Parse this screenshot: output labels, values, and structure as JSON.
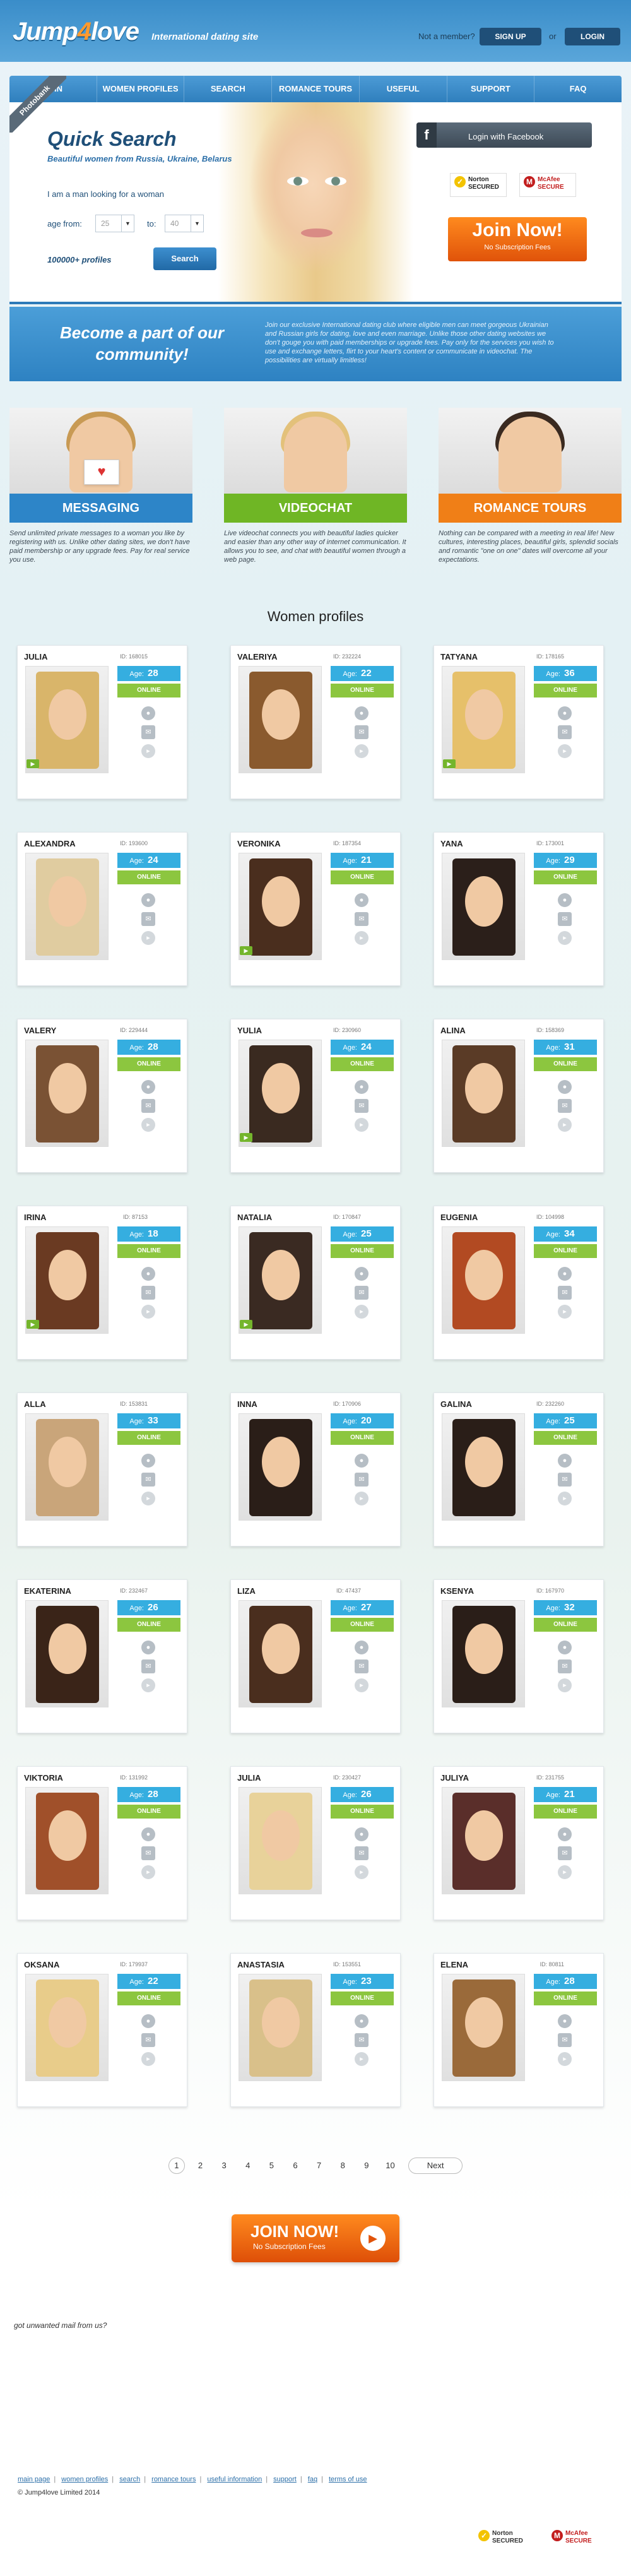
{
  "header": {
    "logo_main": "Jump",
    "logo_four": "4",
    "logo_end": "love",
    "tagline": "International dating site",
    "not_member": "Not a member?",
    "signup": "SIGN UP",
    "or": "or",
    "login": "LOGIN"
  },
  "nav": [
    "JOIN",
    "WOMEN PROFILES",
    "SEARCH",
    "ROMANCE TOURS",
    "USEFUL INFORMATION",
    "SUPPORT",
    "FAQ"
  ],
  "ribbon": "Photobank",
  "quick_search": {
    "title": "Quick Search",
    "subtitle": "Beautiful women from Russia, Ukraine, Belarus",
    "looking": "I am a man looking for a woman",
    "age_from": "age from:",
    "age_to": "to:",
    "from_value": "25",
    "to_value": "40",
    "profiles": "100000+ profiles",
    "search_btn": "Search"
  },
  "facebook": {
    "icon": "f",
    "label": "Login with Facebook"
  },
  "seals": {
    "norton": "Norton SECURED",
    "mcafee": "McAfee SECURE"
  },
  "join_hero": {
    "big": "Join Now!",
    "small": "No Subscription Fees"
  },
  "community": {
    "title": "Become a part of our community!",
    "text": "Join our exclusive International dating club where eligible men can meet gorgeous Ukrainian and Russian girls for dating, love and even marriage. Unlike those other dating websites we don't gouge you with paid memberships or upgrade fees. Pay only for the services you wish to use and exchange letters, flirt to your heart's content or communicate in videochat. The possibilities are virtually limitless!"
  },
  "features": [
    {
      "label": "MESSAGING",
      "desc": "Send unlimited private messages to a woman you like by registering with us. Unlike other dating sites, we don't have paid membership or any upgrade fees. Pay for real service you use."
    },
    {
      "label": "VIDEOCHAT",
      "desc": "Live videochat connects you with beautiful ladies quicker and easier than any other way of internet communication. It allows you to see, and chat with beautiful women through a web page."
    },
    {
      "label": "ROMANCE TOURS",
      "desc": "Nothing can be compared with a meeting in real life! New cultures, interesting places, beautiful girls, splendid socials and romantic \"one on one\" dates will overcome all your expectations."
    }
  ],
  "women_title": "Women profiles",
  "age_label": "Age:",
  "online_label": "ONLINE",
  "profiles": [
    {
      "name": "JULIA",
      "id": "ID: 168015",
      "age": "28",
      "cam": true,
      "hair": "#d9b56a"
    },
    {
      "name": "VALERIYA",
      "id": "ID: 232224",
      "age": "22",
      "cam": false,
      "hair": "#8a5a2e"
    },
    {
      "name": "TATYANA",
      "id": "ID: 178165",
      "age": "36",
      "cam": true,
      "hair": "#e6c06a"
    },
    {
      "name": "ALEXANDRA",
      "id": "ID: 193600",
      "age": "24",
      "cam": false,
      "hair": "#e0cca0"
    },
    {
      "name": "VERONIKA",
      "id": "ID: 187354",
      "age": "21",
      "cam": true,
      "hair": "#4a2e1e"
    },
    {
      "name": "YANA",
      "id": "ID: 173001",
      "age": "29",
      "cam": false,
      "hair": "#2b1f1a"
    },
    {
      "name": "VALERY",
      "id": "ID: 229444",
      "age": "28",
      "cam": false,
      "hair": "#7a5234"
    },
    {
      "name": "YULIA",
      "id": "ID: 230960",
      "age": "24",
      "cam": true,
      "hair": "#3a2a20"
    },
    {
      "name": "ALINA",
      "id": "ID: 158369",
      "age": "31",
      "cam": false,
      "hair": "#5a3b26"
    },
    {
      "name": "IRINA",
      "id": "ID: 87153",
      "age": "18",
      "cam": true,
      "hair": "#6a3a22"
    },
    {
      "name": "NATALIA",
      "id": "ID: 170847",
      "age": "25",
      "cam": true,
      "hair": "#3a2a22"
    },
    {
      "name": "EUGENIA",
      "id": "ID: 104998",
      "age": "34",
      "cam": false,
      "hair": "#b24a22"
    },
    {
      "name": "ALLA",
      "id": "ID: 153831",
      "age": "33",
      "cam": false,
      "hair": "#c9a57a"
    },
    {
      "name": "INNA",
      "id": "ID: 170906",
      "age": "20",
      "cam": false,
      "hair": "#2a1e18"
    },
    {
      "name": "GALINA",
      "id": "ID: 232260",
      "age": "25",
      "cam": false,
      "hair": "#2a1e18"
    },
    {
      "name": "EKATERINA",
      "id": "ID: 232467",
      "age": "26",
      "cam": false,
      "hair": "#3a2418"
    },
    {
      "name": "LIZA",
      "id": "ID: 47437",
      "age": "27",
      "cam": false,
      "hair": "#4a2e1e"
    },
    {
      "name": "KSENYA",
      "id": "ID: 167970",
      "age": "32",
      "cam": false,
      "hair": "#2a1e18"
    },
    {
      "name": "VIKTORIA",
      "id": "ID: 131992",
      "age": "28",
      "cam": false,
      "hair": "#a0502a"
    },
    {
      "name": "JULIA",
      "id": "ID: 230427",
      "age": "26",
      "cam": false,
      "hair": "#e8d29a"
    },
    {
      "name": "JULIYA",
      "id": "ID: 231755",
      "age": "21",
      "cam": false,
      "hair": "#5a2e2a"
    },
    {
      "name": "OKSANA",
      "id": "ID: 179937",
      "age": "22",
      "cam": false,
      "hair": "#e8cc8a"
    },
    {
      "name": "ANASTASIA",
      "id": "ID: 153551",
      "age": "23",
      "cam": false,
      "hair": "#d9c08a"
    },
    {
      "name": "ELENA",
      "id": "ID: 80811",
      "age": "28",
      "cam": false,
      "hair": "#9a6a3a"
    }
  ],
  "pagination": {
    "pages": [
      "1",
      "2",
      "3",
      "4",
      "5",
      "6",
      "7",
      "8",
      "9",
      "10"
    ],
    "next": "Next"
  },
  "join_bottom": {
    "big": "JOIN NOW!",
    "small": "No Subscription Fees"
  },
  "unwanted": "got unwanted mail from us?",
  "footer": {
    "links": [
      "main page",
      "women profiles",
      "search",
      "romance tours",
      "useful information",
      "support",
      "faq",
      "terms of use"
    ],
    "copyright": "© Jump4love Limited 2014"
  },
  "colors": {
    "primary": "#2d85c8",
    "accent_orange": "#f07f17",
    "online_green": "#8cc63f",
    "age_blue": "#35aee0"
  }
}
